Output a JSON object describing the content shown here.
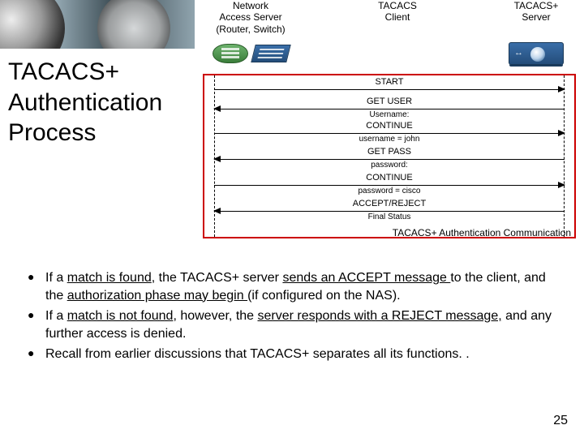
{
  "title_line1": "TACACS+",
  "title_line2": "Authentication",
  "title_line3": "Process",
  "diagram": {
    "labels": {
      "nas": "Network\nAccess Server\n(Router, Switch)",
      "client": "TACACS\nClient",
      "server": "TACACS+\nServer"
    },
    "messages": [
      {
        "dir": "r",
        "label": "START",
        "sub": ""
      },
      {
        "dir": "l",
        "label": "GET USER",
        "sub": "Username:"
      },
      {
        "dir": "r",
        "label": "CONTINUE",
        "sub": "username = john"
      },
      {
        "dir": "l",
        "label": "GET PASS",
        "sub": "password:"
      },
      {
        "dir": "r",
        "label": "CONTINUE",
        "sub": "password = cisco"
      },
      {
        "dir": "l",
        "label": "ACCEPT/REJECT",
        "sub": "Final Status"
      }
    ],
    "caption": "TACACS+ Authentication Communication"
  },
  "bullets": [
    {
      "pre": "If a ",
      "u1": "match is found",
      "mid1": ", the TACACS+ server ",
      "u2": "sends an ACCEPT message ",
      "mid2": "to the client, and the ",
      "u3": "authorization phase may begin ",
      "post": "(if configured on the NAS)."
    },
    {
      "pre": "If a ",
      "u1": "match is not found",
      "mid1": ", however, the ",
      "u2": "server responds with a REJECT message,",
      "mid2": " and any further access is denied.",
      "u3": "",
      "post": ""
    },
    {
      "pre": "Recall from earlier discussions that TACACS+ separates all its functions. .",
      "u1": "",
      "mid1": "",
      "u2": "",
      "mid2": "",
      "u3": "",
      "post": ""
    }
  ],
  "page": "25"
}
